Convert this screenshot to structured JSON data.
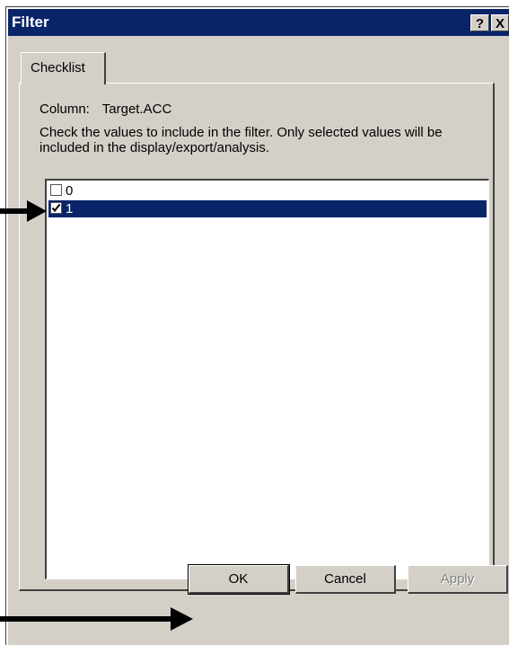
{
  "window": {
    "title": "Filter",
    "help_label": "?",
    "close_label": "X"
  },
  "tabs": [
    {
      "label": "Checklist",
      "active": true
    }
  ],
  "column": {
    "label": "Column:",
    "value": "Target.ACC"
  },
  "instructions": "Check the values to include in the filter.  Only selected values will be included in the display/export/analysis.",
  "list": {
    "items": [
      {
        "label": "0",
        "checked": false,
        "selected": false
      },
      {
        "label": "1",
        "checked": true,
        "selected": true
      }
    ]
  },
  "buttons": {
    "ok": "OK",
    "cancel": "Cancel",
    "apply": "Apply"
  },
  "colors": {
    "titlebar": "#0a246a",
    "face": "#d4d0c8",
    "selection": "#0a246a"
  }
}
